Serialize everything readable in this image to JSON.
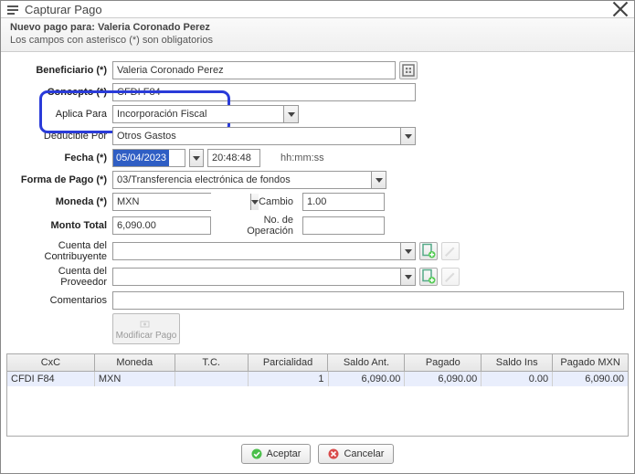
{
  "window": {
    "title": "Capturar Pago"
  },
  "subheader": {
    "line1_prefix": "Nuevo pago para: ",
    "person": "Valeria Coronado Perez",
    "line2": "Los campos con asterisco (*) son obligatorios"
  },
  "labels": {
    "beneficiario": "Beneficiario (*)",
    "concepto": "Concepto (*)",
    "aplica_para": "Aplica Para",
    "deducible_por": "Deducible Por",
    "fecha": "Fecha (*)",
    "hhmmss": "hh:mm:ss",
    "forma_pago": "Forma de Pago (*)",
    "moneda": "Moneda (*)",
    "tipo_cambio": "Tipo de Cambio",
    "monto_total": "Monto Total",
    "no_operacion": "No. de Operación",
    "cuenta_contrib": "Cuenta del Contribuyente",
    "cuenta_prov": "Cuenta del Proveedor",
    "comentarios": "Comentarios",
    "modificar_pago": "Modificar Pago"
  },
  "values": {
    "beneficiario": "Valeria Coronado Perez",
    "concepto": "CFDI F84",
    "aplica_para": "Incorporación Fiscal",
    "deducible_por": "Otros Gastos",
    "fecha": "05/04/2023",
    "hora": "20:48:48",
    "forma_pago": "03/Transferencia electrónica de fondos",
    "moneda": "MXN",
    "tipo_cambio": "1.00",
    "monto_total": "6,090.00",
    "no_operacion": "",
    "cuenta_contrib": "",
    "cuenta_prov": "",
    "comentarios": ""
  },
  "grid": {
    "headers": {
      "cxc": "CxC",
      "moneda": "Moneda",
      "tc": "T.C.",
      "parcialidad": "Parcialidad",
      "saldo_ant": "Saldo Ant.",
      "pagado": "Pagado",
      "saldo_ins": "Saldo Ins",
      "pagado_mxn": "Pagado MXN"
    },
    "rows": [
      {
        "cxc": "CFDI F84",
        "moneda": "MXN",
        "tc": "",
        "parcialidad": "1",
        "saldo_ant": "6,090.00",
        "pagado": "6,090.00",
        "saldo_ins": "0.00",
        "pagado_mxn": "6,090.00"
      }
    ]
  },
  "buttons": {
    "aceptar": "Aceptar",
    "cancelar": "Cancelar"
  }
}
